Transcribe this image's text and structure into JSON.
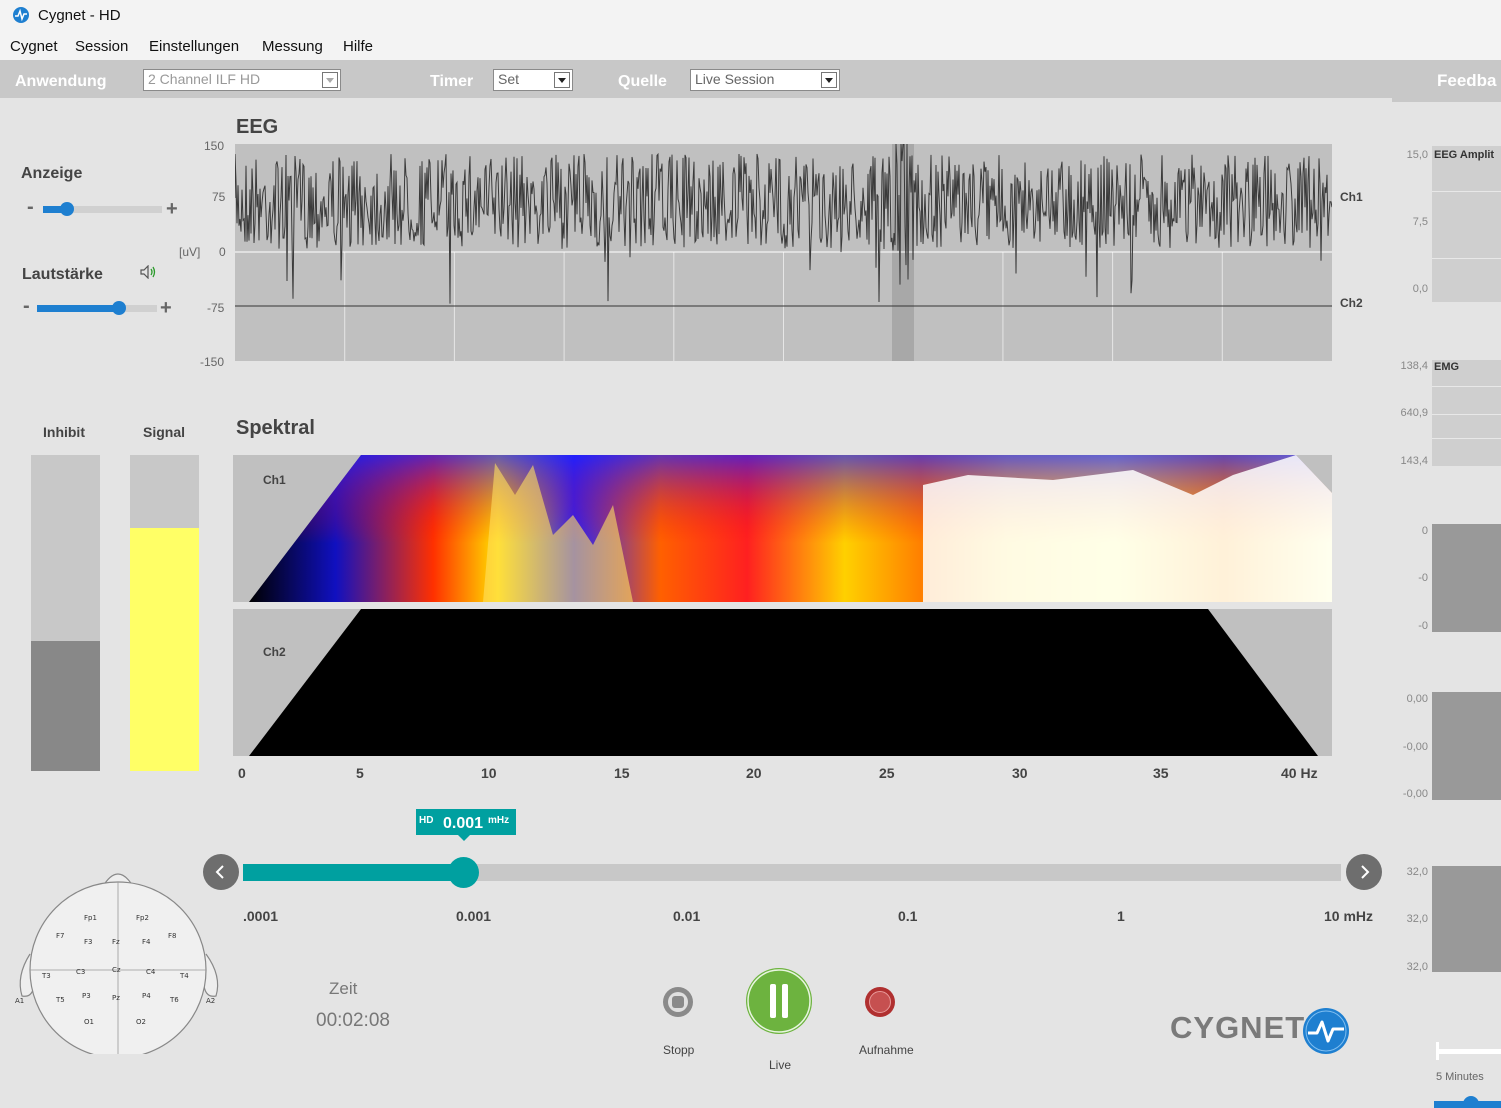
{
  "window": {
    "title": "Cygnet  - HD"
  },
  "menu": [
    "Cygnet",
    "Session",
    "Einstellungen",
    "Messung",
    "Hilfe"
  ],
  "toolbar": {
    "anwendung_label": "Anwendung",
    "anwendung_value": "2 Channel ILF HD",
    "timer_label": "Timer",
    "timer_value": "Set",
    "quelle_label": "Quelle",
    "quelle_value": "Live Session",
    "feedback_label": "Feedba"
  },
  "left": {
    "anzeige_label": "Anzeige",
    "anzeige_level": 0.2,
    "lautstaerke_label": "Lautstärke",
    "lautstaerke_level": 0.68,
    "inhibit_label": "Inhibit",
    "inhibit_level": 0.41,
    "signal_label": "Signal",
    "signal_level": 0.77,
    "minus": "-",
    "plus": "+"
  },
  "eeg": {
    "title": "EEG",
    "unit": "[uV]",
    "y_ticks": [
      "150",
      "75",
      "0",
      "-75",
      "-150"
    ],
    "ch1": "Ch1",
    "ch2": "Ch2"
  },
  "spectral": {
    "title": "Spektral",
    "ch1": "Ch1",
    "ch2": "Ch2",
    "freq_ticks": [
      "0",
      "5",
      "10",
      "15",
      "20",
      "25",
      "30",
      "35",
      "40 Hz"
    ]
  },
  "frequency_slider": {
    "badge_prefix": "HD",
    "badge_value": "0.001",
    "badge_unit": "mHz",
    "position": 0.2,
    "ticks": [
      ".0001",
      "0.001",
      "0.01",
      "0.1",
      "1",
      "10 mHz"
    ]
  },
  "electrodes": [
    "Fp1",
    "Fp2",
    "F7",
    "F3",
    "Fz",
    "F4",
    "F8",
    "T3",
    "C3",
    "Cz",
    "C4",
    "T4",
    "T5",
    "P3",
    "Pz",
    "P4",
    "T6",
    "O1",
    "O2",
    "A1",
    "A2"
  ],
  "time": {
    "label": "Zeit",
    "value": "00:02:08"
  },
  "controls": {
    "stop": "Stopp",
    "live": "Live",
    "record": "Aufnahme"
  },
  "brand": "CYGNET",
  "right_panel": {
    "eeg_title": "EEG Amplit",
    "eeg_scale": [
      "15,0",
      "7,5",
      "0,0"
    ],
    "emg_title": "EMG",
    "emg_scale": [
      "138,4",
      "640,9",
      "143,4"
    ],
    "s3_scale": [
      "0",
      "-0",
      "-0"
    ],
    "s4_scale": [
      "0,00",
      "-0,00",
      "-0,00"
    ],
    "s5_scale": [
      "32,0",
      "32,0",
      "32,0"
    ],
    "duration_label": "5 Minutes"
  },
  "colors": {
    "accent": "#1e7fd0",
    "teal": "#00a0a0",
    "signal": "#ffff66",
    "live": "#6db33f",
    "record": "#b03030"
  }
}
